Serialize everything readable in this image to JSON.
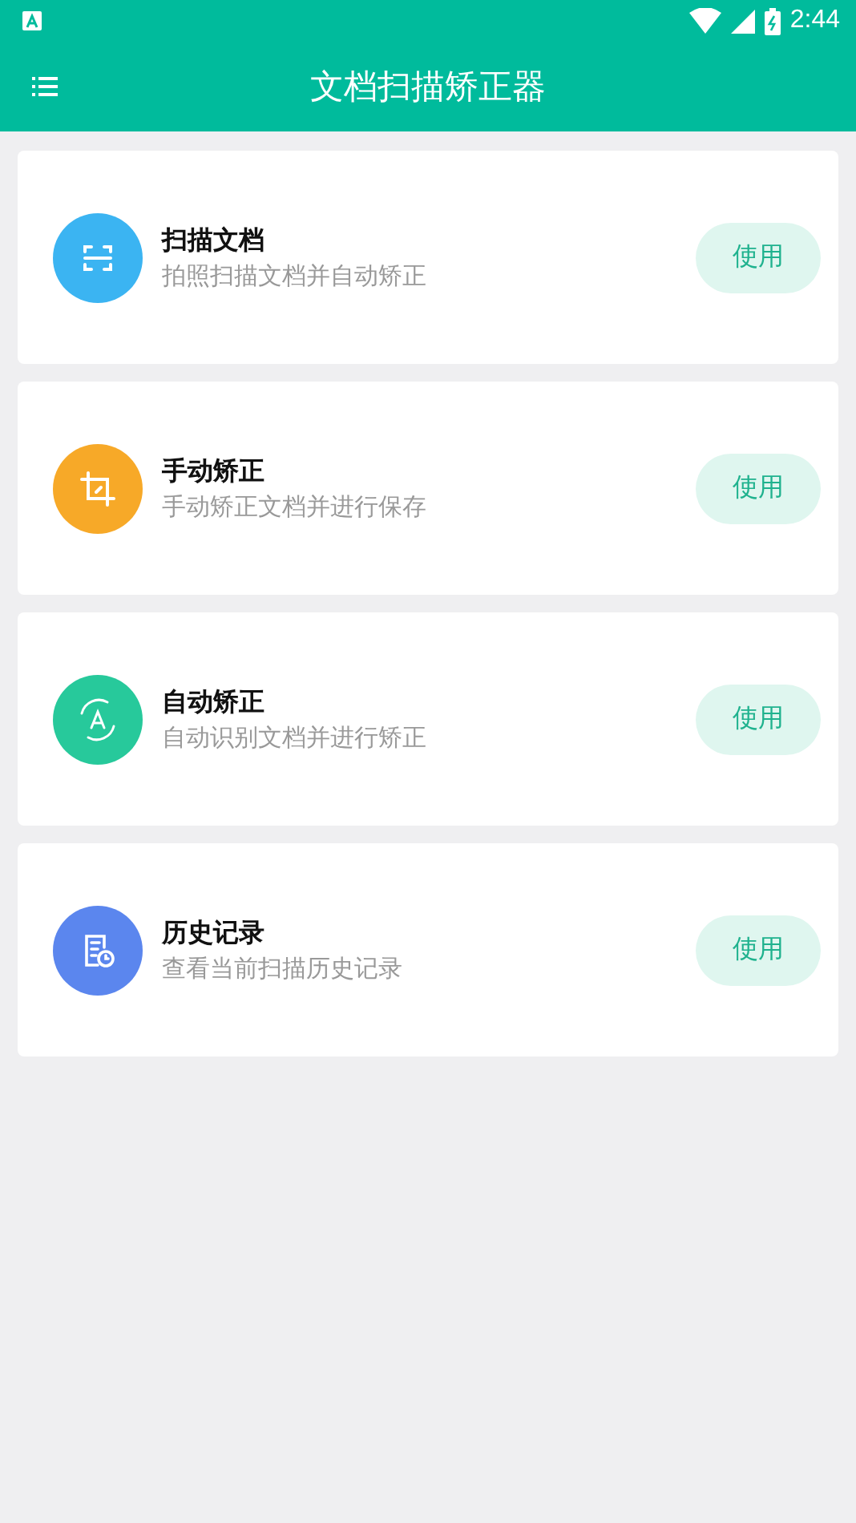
{
  "status_bar": {
    "time": "2:44"
  },
  "app_bar": {
    "title": "文档扫描矫正器"
  },
  "features": [
    {
      "kind": "scan",
      "color": "#3bb4f2",
      "title": "扫描文档",
      "subtitle": "拍照扫描文档并自动矫正",
      "button": "使用"
    },
    {
      "kind": "crop",
      "color": "#f7a928",
      "title": "手动矫正",
      "subtitle": "手动矫正文档并进行保存",
      "button": "使用"
    },
    {
      "kind": "auto",
      "color": "#27c99b",
      "title": "自动矫正",
      "subtitle": "自动识别文档并进行矫正",
      "button": "使用"
    },
    {
      "kind": "history",
      "color": "#5b86ee",
      "title": "历史记录",
      "subtitle": "查看当前扫描历史记录",
      "button": "使用"
    }
  ]
}
